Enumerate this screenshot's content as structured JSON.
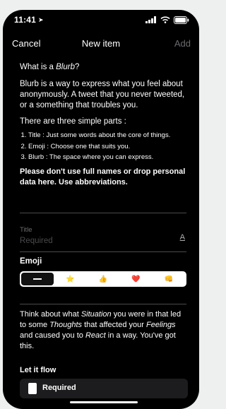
{
  "status": {
    "time": "11:41",
    "loc_icon": "location-arrow-icon"
  },
  "nav": {
    "cancel": "Cancel",
    "title": "New item",
    "add": "Add"
  },
  "intro": {
    "q_prefix": "What is a ",
    "q_term": "Blurb",
    "q_suffix": "?",
    "description": "Blurb is a way to express what you feel about anonymously. A tweet that you never tweeted, or a something that troubles you.",
    "parts_intro": "There are three simple parts :",
    "parts": [
      "Title : Just some words about the core of things.",
      "Emoji : Choose one that suits you.",
      "Blurb : The space where you can express."
    ],
    "warning": "Please don't use full names or drop personal data here. Use abbreviations."
  },
  "title_field": {
    "label": "Title",
    "placeholder": "Required",
    "icon": "text-format-icon",
    "icon_glyph": "A"
  },
  "emoji": {
    "label": "Emoji",
    "options": [
      {
        "name": "none",
        "glyph": ""
      },
      {
        "name": "star",
        "glyph": "⭐"
      },
      {
        "name": "thumbs-up",
        "glyph": "👍"
      },
      {
        "name": "heart",
        "glyph": "❤️"
      },
      {
        "name": "fist",
        "glyph": "👊"
      }
    ],
    "selected": 0
  },
  "prompt": {
    "t1": "Think about what ",
    "situation": "Situation",
    "t2": " you were in that led to some ",
    "thoughts": "Thoughts",
    "t3": " that affected your ",
    "feelings": "Feelings",
    "t4": " and caused you to ",
    "react": "React",
    "t5": " in a way. You've got this."
  },
  "flow": {
    "label": "Let it flow",
    "placeholder": "Required"
  }
}
